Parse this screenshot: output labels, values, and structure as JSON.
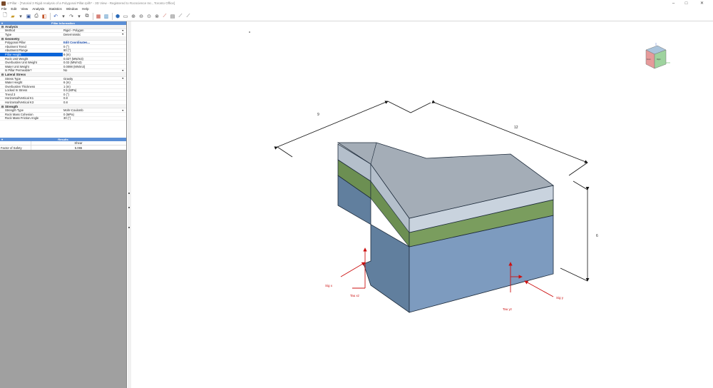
{
  "window": {
    "title": "crPillar - [Tutorial 3 Rigid Analysis of a Polygonal Pillar.rpilh* - 3D View - Registered to Rocscience Inc., Toronto Office]"
  },
  "menu": [
    "File",
    "Edit",
    "View",
    "Analysis",
    "Statistics",
    "Window",
    "Help"
  ],
  "pillar_info": {
    "header": "Pillar Information",
    "analysis": {
      "label": "Analysis",
      "rows": [
        {
          "k": "Method",
          "v": "Rigid - Polygon"
        },
        {
          "k": "Type",
          "v": "Deterministic"
        }
      ]
    },
    "geometry": {
      "label": "Geometry",
      "rows": [
        {
          "k": "Polygonal Pillar",
          "v": "Edit Coordinates..."
        },
        {
          "k": "Abutment Trend",
          "v": "0 (°)"
        },
        {
          "k": "Abutment Plunge",
          "v": "90 (°)"
        },
        {
          "k": "Pillar Height",
          "v": "6 (m)"
        },
        {
          "k": "Rock Unit Weight",
          "v": "0.027 (MN/m3)"
        },
        {
          "k": "Overburden Unit Weight",
          "v": "0.02 (MN/m3)"
        },
        {
          "k": "Water Unit Weight",
          "v": "0.0098 (MN/m3)"
        },
        {
          "k": "Is Pillar Permeable?",
          "v": "No"
        }
      ]
    },
    "lateral": {
      "label": "Lateral Stress",
      "rows": [
        {
          "k": "Stress Type",
          "v": "Gravity"
        },
        {
          "k": "Water Height",
          "v": "6 (m)"
        },
        {
          "k": "Overburden Thickness",
          "v": "1 (m)"
        },
        {
          "k": "Locked In Stress",
          "v": "0.5 (MPa)"
        },
        {
          "k": "Trend 3",
          "v": "0 (°)"
        },
        {
          "k": "Horizontal/Vertical K1",
          "v": "0.8"
        },
        {
          "k": "Horizontal/Vertical K3",
          "v": "0.8"
        }
      ]
    },
    "strength": {
      "label": "Strength",
      "rows": [
        {
          "k": "Strength Type",
          "v": "Mohr-Coulomb"
        },
        {
          "k": "Rock Mass Cohesion",
          "v": "0 (MPa)"
        },
        {
          "k": "Rock Mass Friction Angle",
          "v": "30 (°)"
        }
      ]
    }
  },
  "results": {
    "header": "Results",
    "col": "Shear",
    "row_label": "Factor of Safety",
    "value": "5.065"
  },
  "viewport": {
    "dim_top_left": "9",
    "dim_top_right": "12",
    "dim_height": "6",
    "sig_x": "Sig x",
    "tau_xz": "Tau xz",
    "tau_yz": "Tau yz",
    "sig_y": "Sig y",
    "cube_front": "Front",
    "cube_right": "Right"
  },
  "colors": {
    "top": "#a4adb7",
    "light_band": "#c9d3de",
    "green": "#7a9d5e",
    "blue_front": "#7d9bbf",
    "blue_side": "#617f9e",
    "arrow": "#cc1111"
  }
}
